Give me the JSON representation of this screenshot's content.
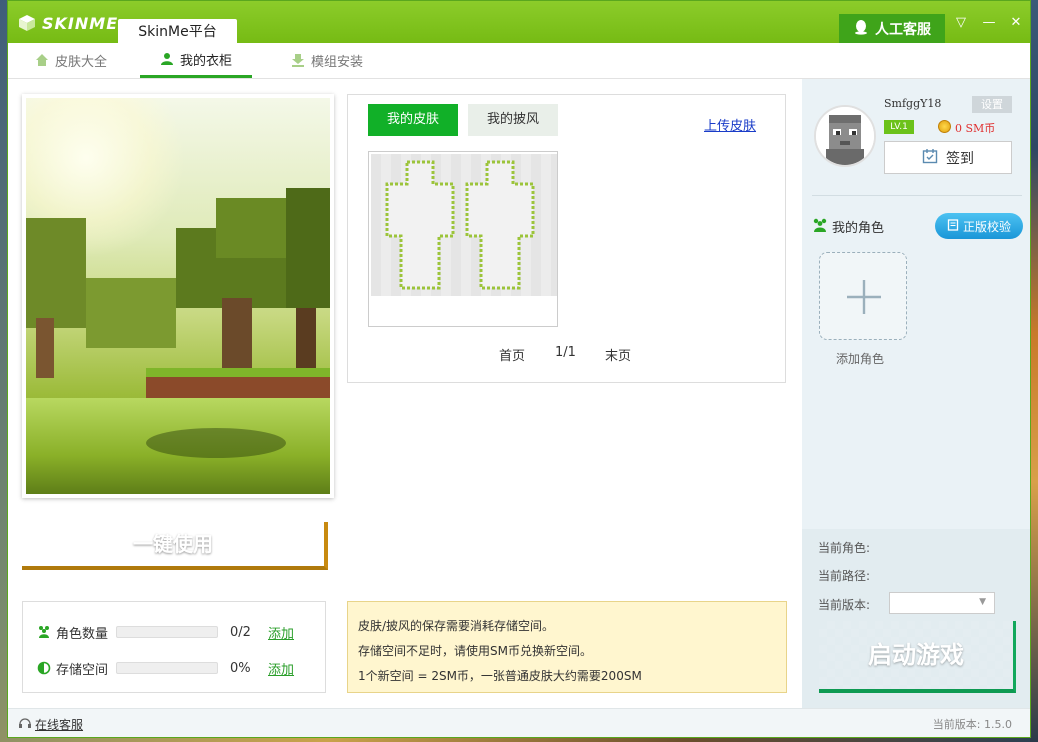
{
  "app": {
    "logo_text": "SKINME",
    "title_tab": "SkinMe平台",
    "support_label": "人工客服"
  },
  "nav": {
    "items": [
      {
        "label": "皮肤大全",
        "icon": "home-icon"
      },
      {
        "label": "我的衣柜",
        "icon": "user-icon"
      },
      {
        "label": "模组安装",
        "icon": "download-icon"
      }
    ]
  },
  "preview": {
    "use_button_label": "一键使用"
  },
  "stats": {
    "roles": {
      "label": "角色数量",
      "value": "0/2",
      "link": "添加"
    },
    "storage": {
      "label": "存储空间",
      "value": "0%",
      "link": "添加"
    }
  },
  "wardrobe": {
    "tabs": [
      {
        "label": "我的皮肤",
        "active": true
      },
      {
        "label": "我的披风",
        "active": false
      }
    ],
    "upload_label": "上传皮肤",
    "pager": {
      "first": "首页",
      "current": "1/1",
      "last": "末页"
    }
  },
  "info": {
    "lines": [
      "皮肤/披风的保存需要消耗存储空间。",
      "存储空间不足时，请使用SM币兑换新空间。",
      "1个新空间 = 2SM币，一张普通皮肤大约需要200SM"
    ]
  },
  "user": {
    "name": "SmfggY18",
    "settings_label": "设置",
    "level": "LV.1",
    "coins": "0 SM币",
    "signin_label": "签到"
  },
  "roles": {
    "title": "我的角色",
    "verify_label": "正版校验",
    "add_label": "添加角色"
  },
  "launch": {
    "current_role_label": "当前角色:",
    "current_path_label": "当前路径:",
    "current_version_label": "当前版本:",
    "version_value": "",
    "start_label": "启动游戏"
  },
  "footer": {
    "online_support": "在线客服",
    "version_text": "当前版本: 1.5.0"
  },
  "colors": {
    "brand_green": "#76bb14",
    "tab_green": "#11b028",
    "start_green": "#18c670",
    "use_yellow": "#e3a812",
    "link_blue": "#1a3cc8"
  }
}
